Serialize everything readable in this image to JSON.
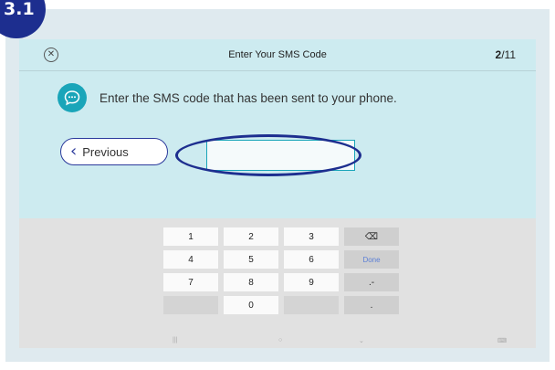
{
  "step_badge": "3.1",
  "header": {
    "close_icon": "close-circle-icon",
    "title": "Enter Your SMS Code",
    "progress_current": "2",
    "progress_total": "/11"
  },
  "prompt": {
    "icon": "chat-bubble-icon",
    "text": "Enter the SMS code that has been sent to your phone."
  },
  "previous_button": {
    "label": "Previous",
    "icon": "chevron-left-icon"
  },
  "sms_code_input": {
    "value": ""
  },
  "keyboard": {
    "rows": [
      [
        "1",
        "2",
        "3",
        "⌫"
      ],
      [
        "4",
        "5",
        "6",
        "Done"
      ],
      [
        "7",
        "8",
        "9",
        ".-"
      ],
      [
        "",
        "0",
        "",
        "."
      ]
    ],
    "nav": [
      "|||",
      "○",
      "⌄",
      "⌨"
    ]
  },
  "colors": {
    "accent": "#1aa5b9",
    "annotation": "#1d2e8f",
    "screen_bg": "#cdebf0"
  }
}
